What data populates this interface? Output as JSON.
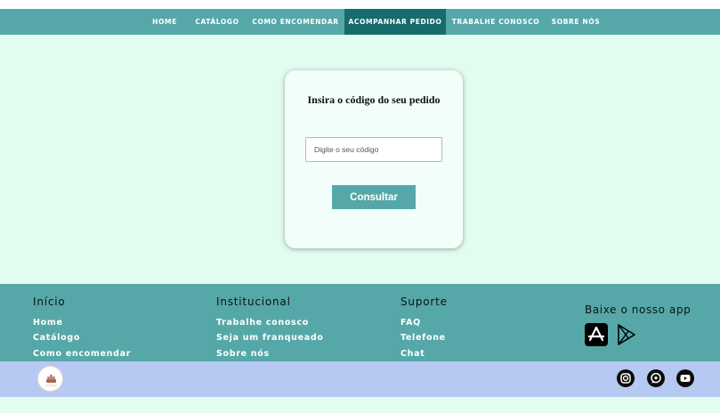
{
  "nav": {
    "items": [
      {
        "label": "HOME"
      },
      {
        "label": "CATÁLOGO"
      },
      {
        "label": "COMO ENCOMENDAR"
      },
      {
        "label": "ACOMPANHAR PEDIDO"
      },
      {
        "label": "TRABALHE CONOSCO"
      },
      {
        "label": "SOBRE NÓS"
      }
    ],
    "active_item": "ACOMPANHAR PEDIDO"
  },
  "tracking": {
    "title": "Insira o código do seu pedido",
    "input_placeholder": "Digite o seu código",
    "input_value": "",
    "button_label": "Consultar"
  },
  "footer": {
    "columns": [
      {
        "heading": "Início",
        "links": [
          "Home",
          "Catálogo",
          "Como encomendar"
        ]
      },
      {
        "heading": "Institucional",
        "links": [
          "Trabalhe conosco",
          "Seja um franqueado",
          "Sobre nós"
        ]
      },
      {
        "heading": "Suporte",
        "links": [
          "FAQ",
          "Telefone",
          "Chat"
        ]
      }
    ],
    "app": {
      "title": "Baixe o nosso app",
      "stores": [
        "app-store-icon",
        "google-play-icon"
      ]
    }
  },
  "social": {
    "icons": [
      "instagram-icon",
      "whatsapp-icon",
      "youtube-icon"
    ]
  },
  "colors": {
    "primary": "#56a8a8",
    "active_nav": "#166b6b",
    "page_background": "#e2fdf0",
    "bottom_bar": "#b6c9f2"
  }
}
